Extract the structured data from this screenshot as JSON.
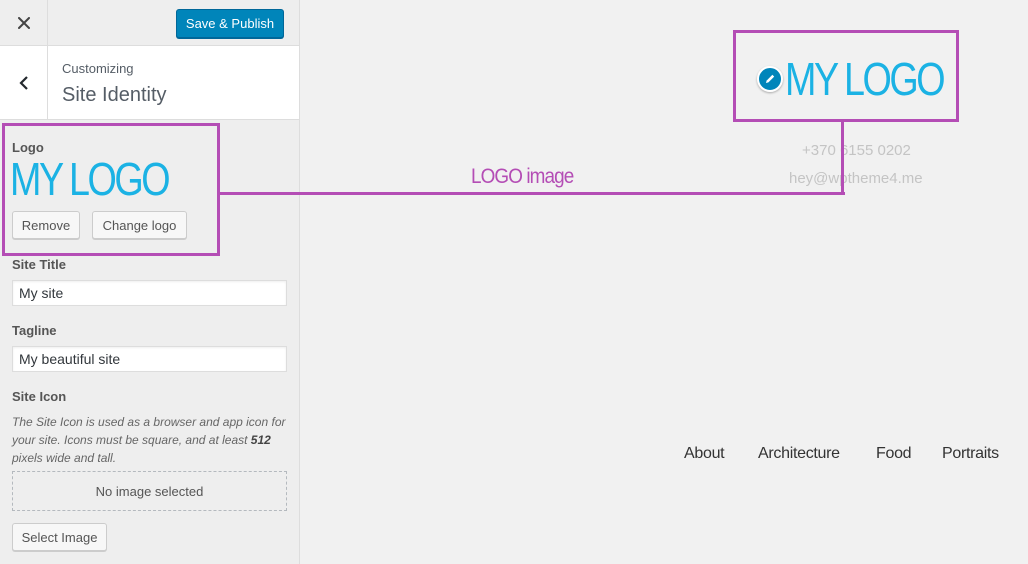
{
  "topbar": {
    "close_icon": "close-icon",
    "save_label": "Save & Publish",
    "accent_color": "#0085ba"
  },
  "section": {
    "breadcrumb": "Customizing",
    "title": "Site Identity"
  },
  "logo_control": {
    "label": "Logo",
    "logo_text": "MY LOGO",
    "remove_label": "Remove",
    "change_label": "Change logo",
    "logo_color": "#1bb2e4"
  },
  "site_title": {
    "label": "Site Title",
    "value": "My site"
  },
  "tagline": {
    "label": "Tagline",
    "value": "My beautiful site"
  },
  "site_icon": {
    "label": "Site Icon",
    "description_pre": "The Site Icon is used as a browser and app icon for your site. Icons must be square, and at least ",
    "description_bold": "512",
    "description_post": " pixels wide and tall.",
    "empty_text": "No image selected",
    "select_label": "Select Image"
  },
  "preview": {
    "logo_text": "MY LOGO",
    "phone": "+370 6155 0202",
    "email": "hey@wptheme4.me",
    "nav": [
      "About",
      "Architecture",
      "Food",
      "Portraits"
    ]
  },
  "annotation": {
    "label": "LOGO image",
    "color": "#b44db5"
  }
}
